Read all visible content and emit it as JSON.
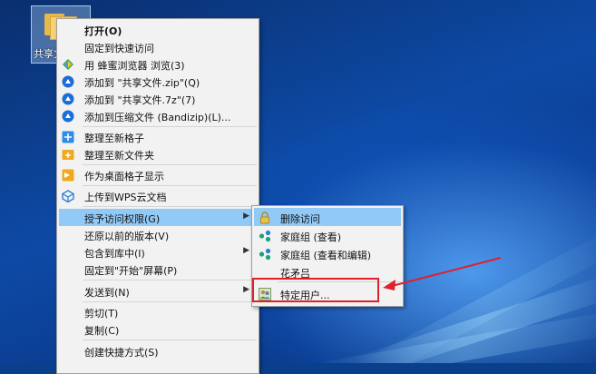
{
  "desktop": {
    "folder": {
      "label": "共享文件",
      "icon": "folder-icon"
    }
  },
  "context_menu": {
    "items": [
      {
        "label": "打开(O)",
        "bold": true,
        "icon": ""
      },
      {
        "label": "固定到快速访问",
        "icon": ""
      },
      {
        "label": "用 蜂蜜浏览器 浏览(3)",
        "icon": "honey-browser-icon"
      },
      {
        "label": "添加到 \"共享文件.zip\"(Q)",
        "icon": "bandizip-icon"
      },
      {
        "label": "添加到 \"共享文件.7z\"(7)",
        "icon": "bandizip-icon"
      },
      {
        "label": "添加到压缩文件 (Bandizip)(L)...",
        "icon": "bandizip-icon"
      },
      {
        "label": "整理至新格子",
        "icon": "fences-add-icon"
      },
      {
        "label": "整理至新文件夹",
        "icon": "folder-add-icon"
      },
      {
        "label": "作为桌面格子显示",
        "icon": "desktop-grid-icon"
      },
      {
        "label": "上传到WPS云文档",
        "icon": "wps-cloud-icon"
      },
      {
        "label": "授予访问权限(G)",
        "icon": "",
        "submenu": true
      },
      {
        "label": "还原以前的版本(V)",
        "icon": ""
      },
      {
        "label": "包含到库中(I)",
        "icon": "",
        "submenu": true
      },
      {
        "label": "固定到\"开始\"屏幕(P)",
        "icon": ""
      },
      {
        "label": "发送到(N)",
        "icon": "",
        "submenu": true
      },
      {
        "label": "剪切(T)",
        "icon": ""
      },
      {
        "label": "复制(C)",
        "icon": ""
      },
      {
        "label": "创建快捷方式(S)",
        "icon": ""
      }
    ]
  },
  "submenu": {
    "items": [
      {
        "label": "删除访问",
        "icon": "lock-icon"
      },
      {
        "label": "家庭组 (查看)",
        "icon": "homegroup-icon"
      },
      {
        "label": "家庭组 (查看和编辑)",
        "icon": "homegroup-icon"
      },
      {
        "label": "花矛吕",
        "icon": ""
      },
      {
        "label": "特定用户...",
        "icon": "users-icon"
      }
    ]
  },
  "colors": {
    "highlight": "#91c9f7",
    "annotation": "#e0202a"
  }
}
